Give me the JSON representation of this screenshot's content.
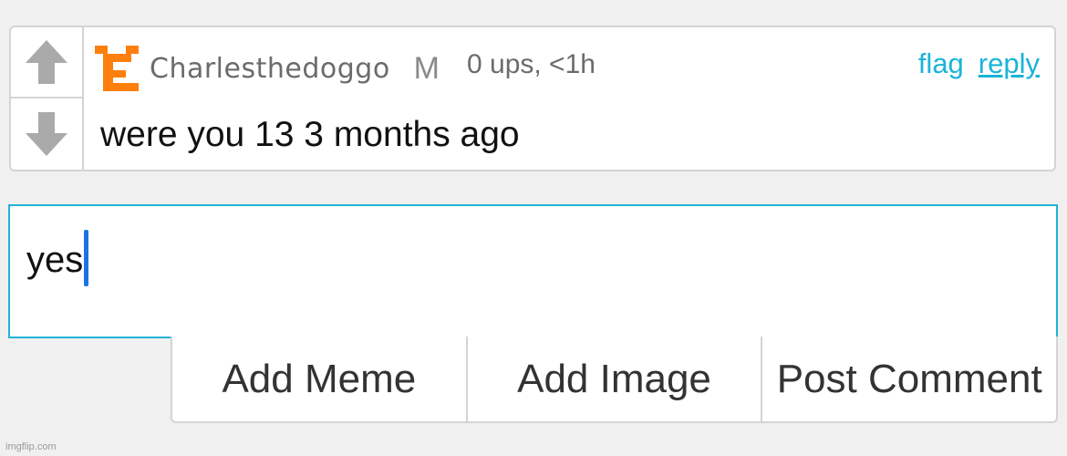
{
  "colors": {
    "background": "#f0f0f0",
    "link": "#1ab4d8",
    "focus_border": "#22b3d6",
    "caret": "#1a73e8",
    "avatar": "#ff7f0e",
    "vote_arrow": "#aaaaaa"
  },
  "comment": {
    "upvote_icon": "upvote-arrow-icon",
    "downvote_icon": "downvote-arrow-icon",
    "avatar_icon": "user-avatar-icon",
    "username": "Charlesthedoggo",
    "badge": "M",
    "stats": "0 ups, <1h",
    "actions": {
      "flag": "flag",
      "reply": "reply"
    },
    "text": "were you 13 3 months ago"
  },
  "reply_box": {
    "value": "yes"
  },
  "buttons": {
    "add_meme": "Add Meme",
    "add_image": "Add Image",
    "post_comment": "Post Comment"
  },
  "watermark": "imgflip.com"
}
